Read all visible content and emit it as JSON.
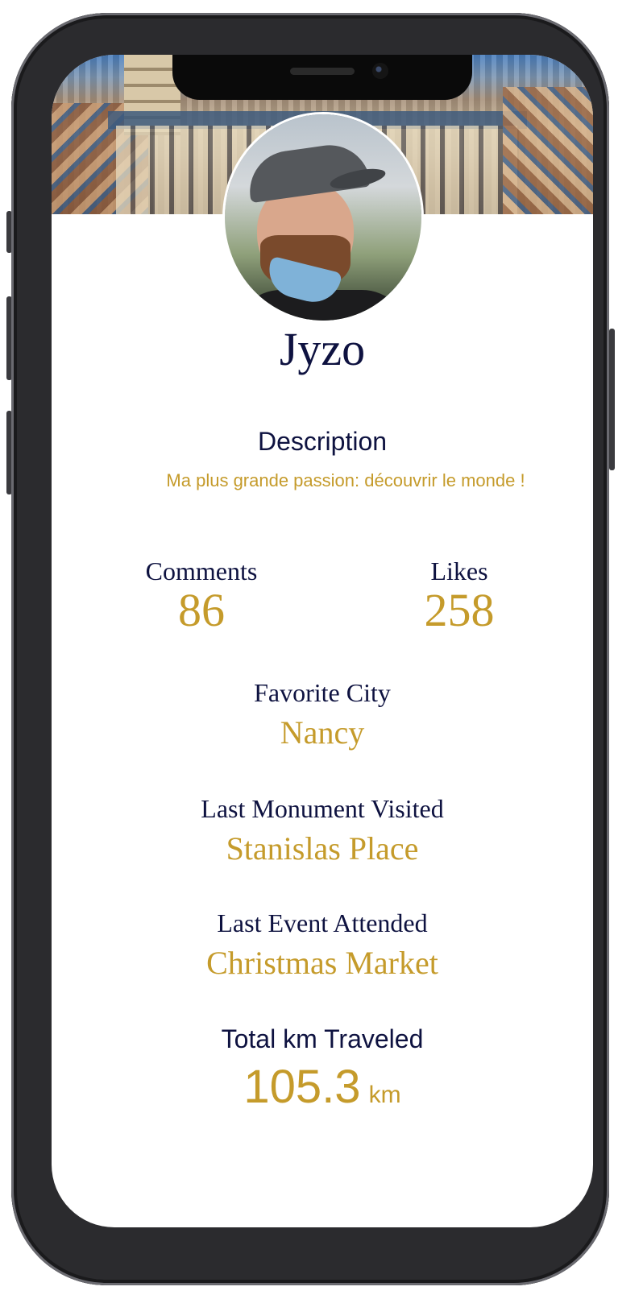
{
  "profile": {
    "name": "Jyzo",
    "description_title": "Description",
    "description_text": "Ma plus grande passion: découvrir le monde !"
  },
  "stats": {
    "comments_label": "Comments",
    "comments_value": "86",
    "likes_label": "Likes",
    "likes_value": "258"
  },
  "details": {
    "favorite_city_label": "Favorite City",
    "favorite_city_value": "Nancy",
    "last_monument_label": "Last Monument Visited",
    "last_monument_value": "Stanislas Place",
    "last_event_label": "Last Event Attended",
    "last_event_value": "Christmas Market"
  },
  "travel": {
    "total_km_label": "Total km Traveled",
    "total_km_value": "105.3",
    "total_km_unit": "km"
  },
  "images": {
    "cover": "city-cover-image",
    "avatar": "profile-avatar-image"
  },
  "colors": {
    "navy": "#0e1240",
    "gold": "#c59b2b"
  }
}
